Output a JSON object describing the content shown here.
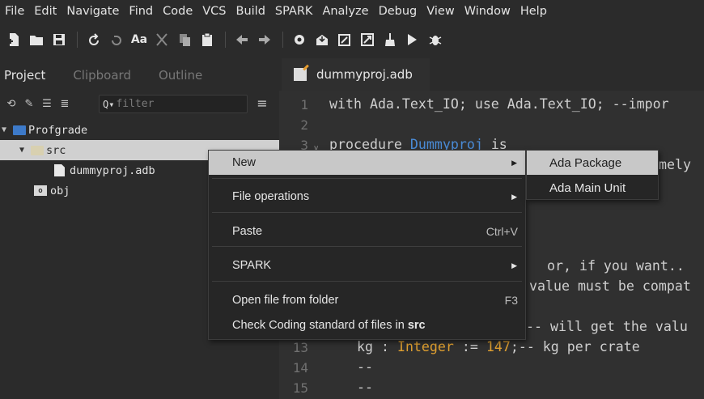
{
  "menubar": [
    "File",
    "Edit",
    "Navigate",
    "Find",
    "Code",
    "VCS",
    "Build",
    "SPARK",
    "Analyze",
    "Debug",
    "View",
    "Window",
    "Help"
  ],
  "toolbar_icons": [
    "new-file-icon",
    "open-folder-icon",
    "save-icon",
    "undo-icon",
    "redo-icon",
    "font-icon",
    "cut-icon",
    "copy-icon",
    "paste-icon",
    "back-arrow-icon",
    "forward-arrow-icon",
    "settings-icon",
    "build-icon",
    "build-all-icon",
    "compile-icon",
    "clean-icon",
    "run-icon",
    "debug-icon"
  ],
  "toolbar": {
    "font_label": "Aa"
  },
  "panel": {
    "tabs": [
      "Project",
      "Clipboard",
      "Outline"
    ],
    "filter_placeholder": "filter"
  },
  "tree": {
    "project": "Profgrade",
    "src": "src",
    "file": "dummyproj.adb",
    "obj": "obj",
    "obj_badge": "o"
  },
  "editor": {
    "tab": "dummyproj.adb",
    "line_numbers": [
      "1",
      "2",
      "3",
      "13",
      "14",
      "15"
    ],
    "line1": "with Ada.Text_IO; use Ada.Text_IO; --impor",
    "line3_kw": "procedure ",
    "line3_name": "Dummyproj",
    "line3_is": " is",
    "frag_a": "mely ",
    "frag_b": "or, if you want..",
    "frag_c": "value must be compat",
    "frag_d": "-- will get the valu",
    "line13_a": "kg : ",
    "line13_type": "Integer",
    "line13_b": " := ",
    "line13_num": "147",
    "line13_c": ";-- kg per crate",
    "line14": "--",
    "line15": "--"
  },
  "context_menu": {
    "new": "New",
    "file_ops": "File operations",
    "paste": "Paste",
    "paste_shortcut": "Ctrl+V",
    "spark": "SPARK",
    "open_folder": "Open file from folder",
    "open_folder_shortcut": "F3",
    "check_coding": "Check Coding standard of files in ",
    "check_coding_target": "src"
  },
  "submenu": {
    "ada_package": "Ada Package",
    "ada_main_unit": "Ada Main Unit"
  }
}
